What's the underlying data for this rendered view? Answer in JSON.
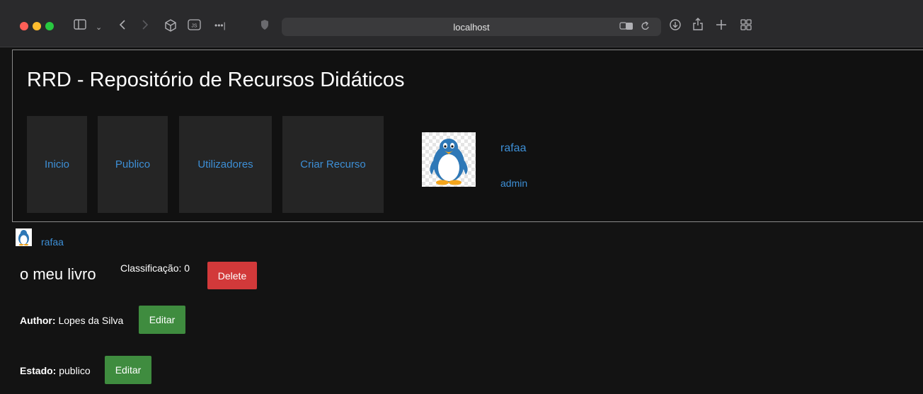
{
  "browser": {
    "url": "localhost",
    "icons": {
      "sidebar": "sidebar-icon",
      "back": "chevron-left-icon",
      "forward": "chevron-right-icon",
      "extension": "cube-icon",
      "js": "js-icon",
      "more": "ellipsis-icon",
      "shield": "shield-icon",
      "translate": "translate-icon",
      "reload": "reload-icon",
      "download": "download-icon",
      "share": "share-icon",
      "new_tab": "plus-icon",
      "tabs": "grid-icon"
    }
  },
  "header": {
    "title": "RRD - Repositório de Recursos Didáticos",
    "nav": [
      {
        "label": "Inicio"
      },
      {
        "label": "Publico"
      },
      {
        "label": "Utilizadores"
      },
      {
        "label": "Criar Recurso"
      }
    ],
    "user": {
      "name": "rafaa",
      "role": "admin"
    }
  },
  "resource": {
    "author_username": "rafaa",
    "title": "o meu livro",
    "rating_label": "Classificação: 0",
    "delete_label": "Delete",
    "fields": [
      {
        "label": "Author:",
        "value": "Lopes da Silva",
        "button": "Editar"
      },
      {
        "label": "Estado:",
        "value": "publico",
        "button": "Editar"
      }
    ]
  },
  "colors": {
    "link": "#3d8fd6",
    "delete": "#d2393a",
    "edit": "#3f8c3f",
    "background": "#131313"
  }
}
